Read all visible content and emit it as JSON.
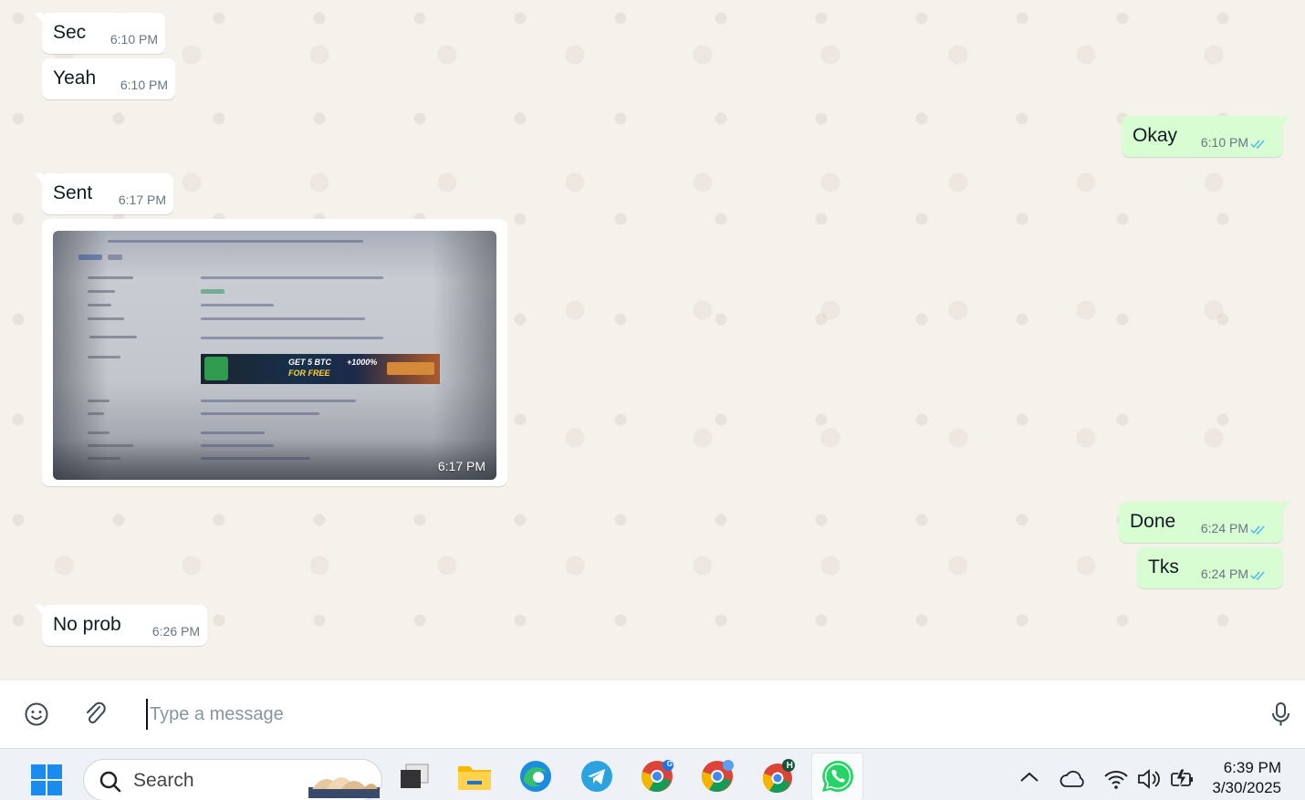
{
  "messages": {
    "sec": {
      "text": "Sec",
      "time": "6:10 PM"
    },
    "yeah": {
      "text": "Yeah",
      "time": "6:10 PM"
    },
    "okay": {
      "text": "Okay",
      "time": "6:10 PM"
    },
    "sent": {
      "text": "Sent",
      "time": "6:17 PM"
    },
    "image": {
      "time": "6:17 PM",
      "banner_line1": "GET 5 BTC",
      "banner_line2": "FOR FREE",
      "banner_bonus": "+1000%"
    },
    "done": {
      "text": "Done",
      "time": "6:24 PM"
    },
    "tks": {
      "text": "Tks",
      "time": "6:24 PM"
    },
    "noprob": {
      "text": "No prob",
      "time": "6:26 PM"
    }
  },
  "composer": {
    "placeholder": "Type a message",
    "emoji_icon": "emoji-icon",
    "attach_icon": "paperclip-icon",
    "mic_icon": "microphone-icon"
  },
  "taskbar": {
    "search_label": "Search",
    "time": "6:39 PM",
    "date": "3/30/2025",
    "chrome_badge_g": "G",
    "chrome_badge_h": "H"
  },
  "colors": {
    "outgoing_bubble": "#d9fdd3",
    "incoming_bubble": "#ffffff",
    "read_ticks": "#53bdeb",
    "whatsapp_green": "#25d366"
  }
}
